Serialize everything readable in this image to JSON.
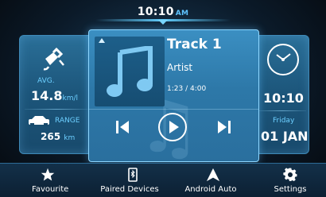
{
  "status": {
    "time": "10:10",
    "ampm": "AM"
  },
  "fuel": {
    "avg_label": "AVG.",
    "avg_value": "14.8",
    "avg_unit": "km/l",
    "range_label": "RANGE",
    "range_value": "265",
    "range_unit": "km"
  },
  "media": {
    "title": "Track 1",
    "artist": "Artist",
    "progress": "1:23 / 4:00"
  },
  "clock": {
    "time": "10:10",
    "day": "Friday",
    "date": "01 JAN"
  },
  "nav": [
    {
      "label": "Favourite",
      "icon": "star-icon"
    },
    {
      "label": "Paired Devices",
      "icon": "phone-icon"
    },
    {
      "label": "Android Auto",
      "icon": "android-auto-icon"
    },
    {
      "label": "Settings",
      "icon": "gear-icon"
    }
  ],
  "colors": {
    "accent": "#6ccfff",
    "panel": "#2a6f98",
    "card": "#3b8fc2"
  }
}
